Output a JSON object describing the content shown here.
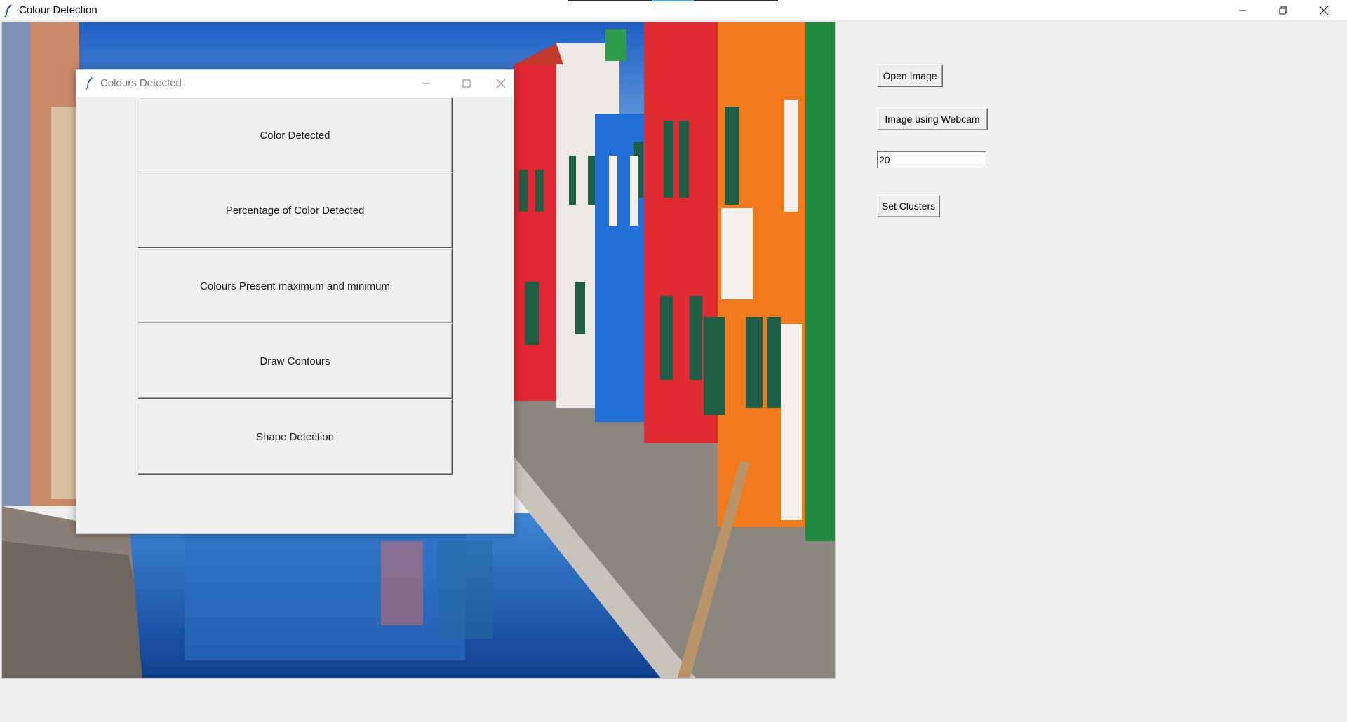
{
  "window": {
    "title": "Colour Detection",
    "icon": "feather-icon"
  },
  "controls": {
    "open_image_label": "Open Image",
    "webcam_label": "Image using Webcam",
    "clusters_value": "20",
    "set_clusters_label": "Set Clusters"
  },
  "popup": {
    "title": "Colours Detected",
    "buttons": [
      "Color Detected",
      "Percentage of Color Detected",
      "Colours Present maximum and minimum",
      "Draw Contours",
      "Shape Detection"
    ]
  },
  "photo": {
    "description_icon": "image-canvas",
    "accent_colors": [
      "#e32b35",
      "#1f6fd6",
      "#f07a1a",
      "#1e8a3e",
      "#2f6db5"
    ]
  }
}
